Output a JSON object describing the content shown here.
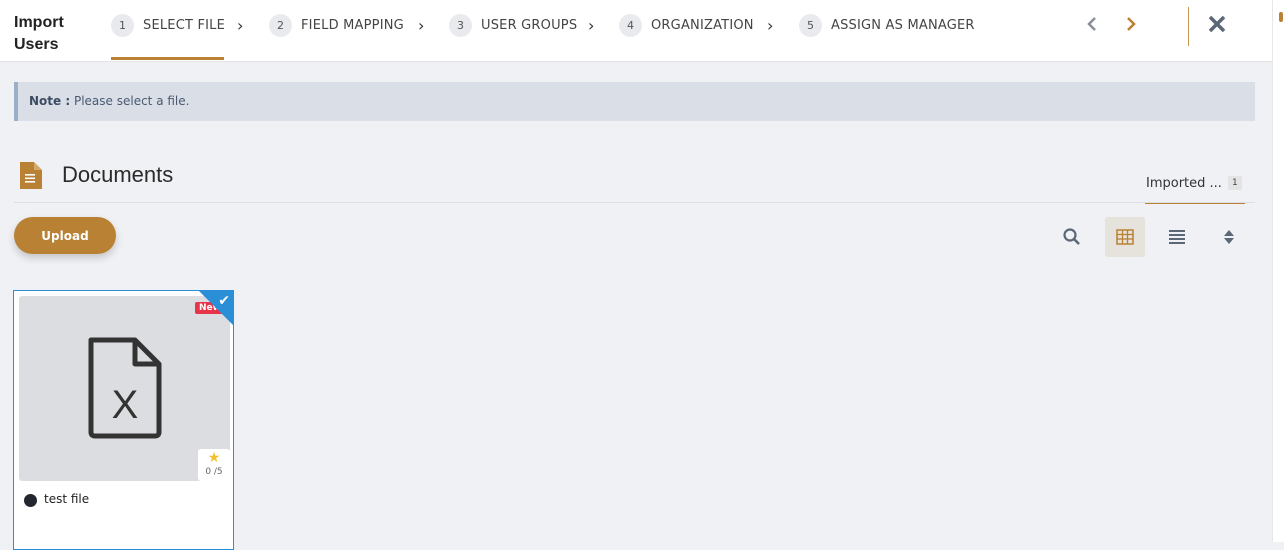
{
  "header": {
    "title_line1": "Import",
    "title_line2": "Users",
    "steps": [
      {
        "num": "1",
        "label": "SELECT FILE"
      },
      {
        "num": "2",
        "label": "FIELD MAPPING"
      },
      {
        "num": "3",
        "label": "USER GROUPS"
      },
      {
        "num": "4",
        "label": "ORGANIZATION"
      },
      {
        "num": "5",
        "label": "ASSIGN AS MANAGER"
      }
    ],
    "active_step": 1,
    "prev_icon": "chevron-left-icon",
    "next_icon": "chevron-right-icon",
    "close_icon": "close-icon"
  },
  "note": {
    "label": "Note :",
    "text": "Please select a file."
  },
  "documents": {
    "title": "Documents",
    "tabs": [
      {
        "label": "Imported ...",
        "count": "1"
      }
    ],
    "upload_label": "Upload",
    "toolbar": {
      "search_icon": "search-icon",
      "grid_icon": "grid-view-icon",
      "list_icon": "list-view-icon",
      "sort_icon": "sort-icon"
    },
    "files": [
      {
        "name": "test file",
        "badge": "New",
        "rating": "0 /5",
        "type_icon": "excel-file-icon",
        "selected": true
      }
    ]
  },
  "colors": {
    "accent": "#b98133",
    "selection": "#2a8fd6",
    "new_badge": "#e8344b",
    "note_bg": "#d9dee7"
  }
}
